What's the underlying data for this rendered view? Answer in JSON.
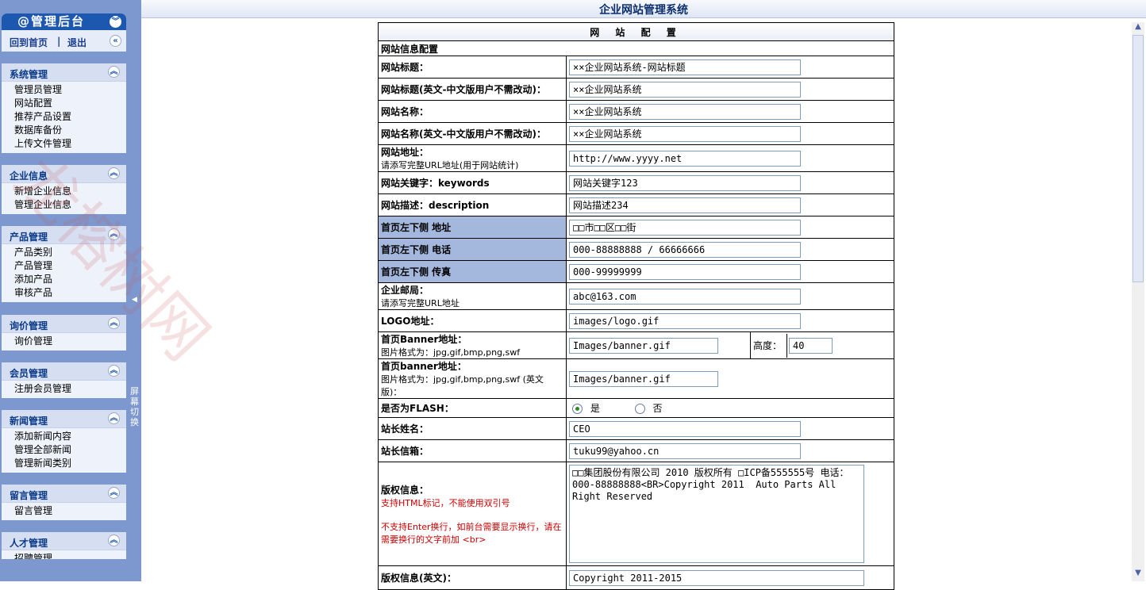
{
  "top_title": "企业网站管理系统",
  "sidebar": {
    "header": "@管理后台",
    "links": {
      "home": "回到首页",
      "sep": "|",
      "logout": "退出"
    },
    "split_text": "屏幕切换",
    "menus": [
      {
        "title": "系统管理",
        "items": [
          "管理员管理",
          "网站配置",
          "推荐产品设置",
          "数据库备份",
          "上传文件管理"
        ]
      },
      {
        "title": "企业信息",
        "items": [
          "新增企业信息",
          "管理企业信息"
        ]
      },
      {
        "title": "产品管理",
        "items": [
          "产品类别",
          "产品管理",
          "添加产品",
          "审核产品"
        ]
      },
      {
        "title": "询价管理",
        "items": [
          "询价管理"
        ]
      },
      {
        "title": "会员管理",
        "items": [
          "注册会员管理"
        ]
      },
      {
        "title": "新闻管理",
        "items": [
          "添加新闻内容",
          "管理全部新闻",
          "管理新闻类别"
        ]
      },
      {
        "title": "留言管理",
        "items": [
          "留言管理"
        ]
      },
      {
        "title": "人才管理",
        "items": [
          "招聘管理"
        ]
      }
    ]
  },
  "form": {
    "title": "网 站 配 置",
    "section": "网站信息配置",
    "site_title_label": "网站标题：",
    "site_title_value": "××企业网站系统-网站标题",
    "site_title_en_label": "网站标题(英文-中文版用户不需改动)：",
    "site_title_en_value": "××企业网站系统",
    "site_name_label": "网站名称：",
    "site_name_value": "××企业网站系统",
    "site_name_en_label": "网站名称(英文-中文版用户不需改动)：",
    "site_name_en_value": "××企业网站系统",
    "site_url_label": "网站地址：",
    "site_url_hint": "请添写完整URL地址(用于网站统计)",
    "site_url_value": "http://www.yyyy.net",
    "keywords_label": "网站关键字：keywords",
    "keywords_value": "网站关键字123",
    "description_label": "网站描述：description",
    "description_value": "网站描述234",
    "address_label": "首页左下侧 地址",
    "address_value": "□□市□□区□□街",
    "phone_label": "首页左下侧 电话",
    "phone_value": "000-88888888 / 66666666",
    "fax_label": "首页左下侧 传真",
    "fax_value": "000-99999999",
    "email_label": "企业邮局：",
    "email_hint": "请添写完整URL地址",
    "email_value": "abc@163.com",
    "logo_label": "LOGO地址：",
    "logo_value": "images/logo.gif",
    "banner_label": "首页Banner地址：",
    "banner_hint": "图片格式为：jpg,gif,bmp,png,swf",
    "banner_value": "Images/banner.gif",
    "height_label": "高度：",
    "height_value": "40",
    "banner_en_label": "首页banner地址：",
    "banner_en_hint": "图片格式为：jpg,gif,bmp,png,swf (英文版)：",
    "banner_en_value": "Images/banner.gif",
    "flash_label": "是否为FLASH：",
    "flash_yes": "是",
    "flash_no": "否",
    "owner_label": "站长姓名：",
    "owner_value": "CEO",
    "owner_email_label": "站长信箱：",
    "owner_email_value": "tuku99@yahoo.cn",
    "copyright_label": "版权信息：",
    "copyright_hint1": "支持HTML标记，不能使用双引号",
    "copyright_hint2": "不支持Enter换行，如前台需要显示换行，请在需要换行的文字前加 <br>",
    "copyright_value": "□□集团股份有限公司 2010 版权所有 □ICP备555555号 电话：000-88888888<BR>Copyright 2011  Auto Parts All Right Reserved",
    "copyright_en_label": "版权信息(英文)：",
    "copyright_en_value": "Copyright 2011-2015"
  },
  "watermark": "龙榕树网"
}
